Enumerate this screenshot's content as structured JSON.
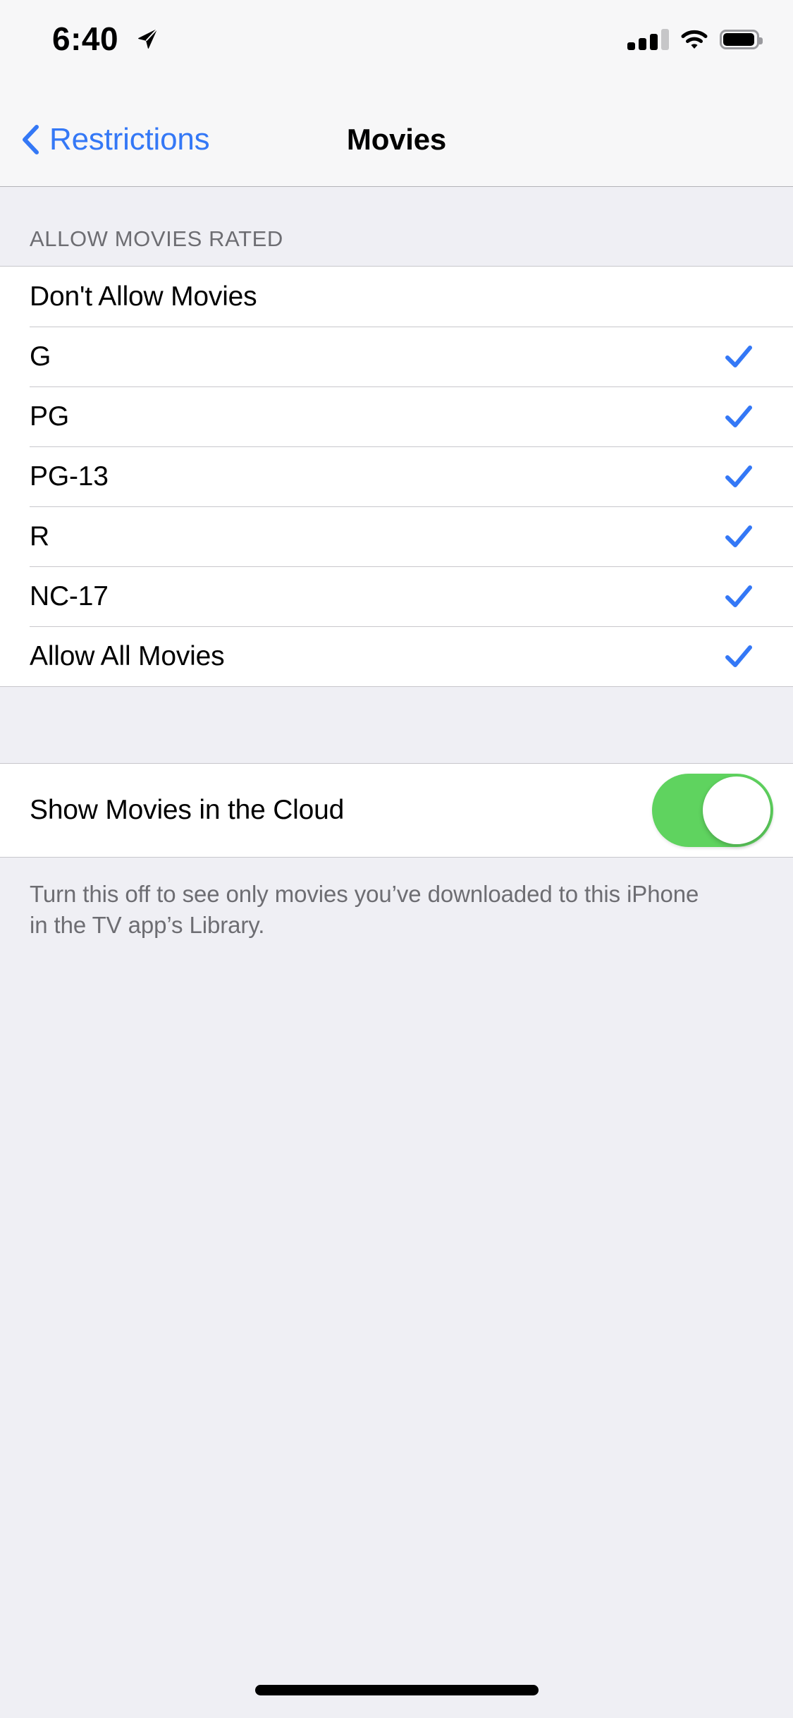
{
  "status_bar": {
    "time": "6:40",
    "location_icon": "location-arrow-icon",
    "signal_icon": "cellular-signal-icon",
    "signal_bars_filled": 3,
    "signal_bars_total": 4,
    "wifi_icon": "wifi-icon",
    "battery_icon": "battery-icon",
    "battery_level_percent": 90
  },
  "nav_bar": {
    "back_label": "Restrictions",
    "back_icon": "chevron-left-icon",
    "title": "Movies"
  },
  "colors": {
    "accent_blue": "#3478F6",
    "check_blue": "#3478F6",
    "switch_on_green": "#5FD35F",
    "background_gray": "#EFEFF4",
    "row_white": "#FFFFFF",
    "separator": "#C8C7CC",
    "secondary_text": "#6D6D72"
  },
  "sections": [
    {
      "header": "ALLOW MOVIES RATED",
      "rows": [
        {
          "label": "Don't Allow Movies",
          "checked": false
        },
        {
          "label": "G",
          "checked": true
        },
        {
          "label": "PG",
          "checked": true
        },
        {
          "label": "PG-13",
          "checked": true
        },
        {
          "label": "R",
          "checked": true
        },
        {
          "label": "NC-17",
          "checked": true
        },
        {
          "label": "Allow All Movies",
          "checked": true
        }
      ]
    },
    {
      "header": "",
      "toggle_row": {
        "label": "Show Movies in the Cloud",
        "value": "on"
      },
      "footer": "Turn this off to see only movies you’ve downloaded to this iPhone in the TV app’s Library."
    }
  ],
  "home_indicator": "home-indicator"
}
